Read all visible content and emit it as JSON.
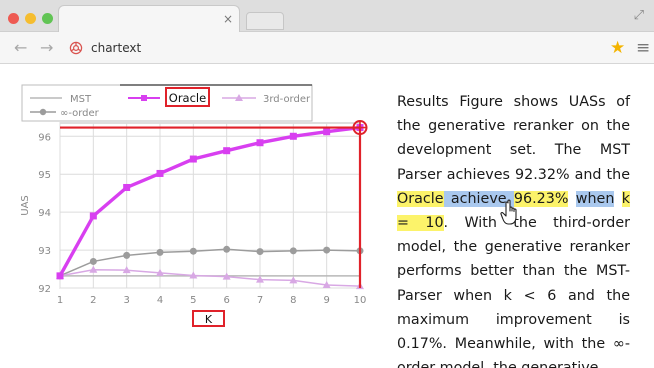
{
  "browser": {
    "tab_close_glyph": "×",
    "url": "chartext",
    "nav_back": "←",
    "nav_forward": "→",
    "bookmark_glyph": "★",
    "menu_glyph": "≡",
    "expand_glyph": "⤢",
    "icons": [
      "window-close-dot",
      "window-minimize-dot",
      "window-maximize-dot",
      "tab-close-icon",
      "expand-icon",
      "back-arrow-icon",
      "forward-arrow-icon",
      "site-icon",
      "bookmark-star-icon",
      "menu-icon",
      "hand-cursor-icon",
      "target-marker-icon"
    ],
    "colors": {
      "close": "#ee5a52",
      "minimize": "#f5bd2f",
      "maximize": "#61c454",
      "star": "#f4b400"
    }
  },
  "chart_data": {
    "type": "line",
    "x": [
      1,
      2,
      3,
      4,
      5,
      6,
      7,
      8,
      9,
      10
    ],
    "xlabel": "K",
    "ylabel": "UAS",
    "xlim": [
      1,
      10
    ],
    "ylim": [
      92,
      96.35
    ],
    "yticks": [
      92,
      93,
      94,
      95,
      96
    ],
    "grid": true,
    "legend_position": "top",
    "series": [
      {
        "name": "MST",
        "values": [
          92.32,
          92.32,
          92.32,
          92.32,
          92.32,
          92.32,
          92.32,
          92.32,
          92.32,
          92.32
        ],
        "color": "#b8b8b8",
        "marker": "none"
      },
      {
        "name": "Oracle",
        "values": [
          92.32,
          93.9,
          94.65,
          95.02,
          95.4,
          95.62,
          95.83,
          96.0,
          96.12,
          96.23
        ],
        "color": "#d83ff0",
        "marker": "square"
      },
      {
        "name": "3rd-order",
        "values": [
          92.32,
          92.48,
          92.47,
          92.4,
          92.33,
          92.3,
          92.22,
          92.2,
          92.08,
          92.05
        ],
        "color": "#d8a8e4",
        "marker": "triangle"
      },
      {
        "name": "∞-order",
        "values": [
          92.32,
          92.7,
          92.86,
          92.94,
          92.97,
          93.02,
          92.96,
          92.98,
          93.0,
          92.98
        ],
        "color": "#9c9c9c",
        "marker": "circle"
      }
    ],
    "annotations": {
      "highlighted_legend": "Oracle",
      "highlighted_xlabel": "K",
      "target_point": {
        "x": 10,
        "y": 96.23
      },
      "box_color": "#e0222a"
    }
  },
  "text": {
    "segments": [
      {
        "t": "Results Figure shows UASs of the generative reranker on the development set. The MST Parser achieves 92.32% and the ",
        "hl": ""
      },
      {
        "t": "Oracle",
        "hl": "y"
      },
      {
        "t": " achieve ",
        "hl": "b"
      },
      {
        "t": "96.23%",
        "hl": "y"
      },
      {
        "t": " ",
        "hl": ""
      },
      {
        "t": "when",
        "hl": "b"
      },
      {
        "t": " ",
        "hl": ""
      },
      {
        "t": "k = 10",
        "hl": "y"
      },
      {
        "t": ". With the third-order model, the generative reranker performs better than the MST-Parser when k < 6 and the maximum improvement is 0.17%. Meanwhile, with the ∞-order model, the generative",
        "hl": ""
      }
    ]
  }
}
